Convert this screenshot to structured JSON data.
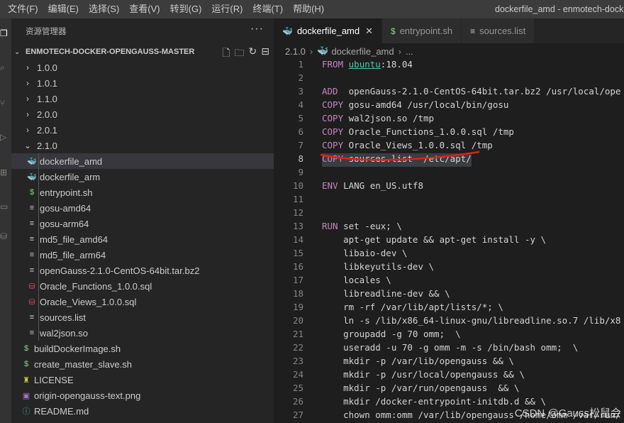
{
  "menu": [
    "文件(F)",
    "编辑(E)",
    "选择(S)",
    "查看(V)",
    "转到(G)",
    "运行(R)",
    "终端(T)",
    "帮助(H)"
  ],
  "window_title": "dockerfile_amd - enmotech-docke",
  "sidebar": {
    "title": "资源管理器",
    "more": "···",
    "root": "ENMOTECH-DOCKER-OPENGAUSS-MASTER",
    "tree": [
      {
        "label": "1.0.0",
        "kind": "folder"
      },
      {
        "label": "1.0.1",
        "kind": "folder"
      },
      {
        "label": "1.1.0",
        "kind": "folder"
      },
      {
        "label": "2.0.0",
        "kind": "folder"
      },
      {
        "label": "2.0.1",
        "kind": "folder"
      },
      {
        "label": "2.1.0",
        "kind": "folder-open"
      },
      {
        "label": "dockerfile_amd",
        "kind": "docker",
        "child": true,
        "selected": true
      },
      {
        "label": "dockerfile_arm",
        "kind": "docker",
        "child": true
      },
      {
        "label": "entrypoint.sh",
        "kind": "shell",
        "child": true
      },
      {
        "label": "gosu-amd64",
        "kind": "file",
        "child": true
      },
      {
        "label": "gosu-arm64",
        "kind": "file",
        "child": true
      },
      {
        "label": "md5_file_amd64",
        "kind": "file",
        "child": true
      },
      {
        "label": "md5_file_arm64",
        "kind": "file",
        "child": true
      },
      {
        "label": "openGauss-2.1.0-CentOS-64bit.tar.bz2",
        "kind": "file",
        "child": true
      },
      {
        "label": "Oracle_Functions_1.0.0.sql",
        "kind": "sql",
        "child": true
      },
      {
        "label": "Oracle_Views_1.0.0.sql",
        "kind": "sql",
        "child": true
      },
      {
        "label": "sources.list",
        "kind": "file",
        "child": true
      },
      {
        "label": "wal2json.so",
        "kind": "file",
        "child": true
      },
      {
        "label": "buildDockerImage.sh",
        "kind": "shell"
      },
      {
        "label": "create_master_slave.sh",
        "kind": "shell"
      },
      {
        "label": "LICENSE",
        "kind": "license"
      },
      {
        "label": "origin-opengauss-text.png",
        "kind": "image"
      },
      {
        "label": "README.md",
        "kind": "info"
      }
    ]
  },
  "tabs": [
    {
      "label": "dockerfile_amd",
      "icon": "docker-icon",
      "active": true,
      "close": "✕"
    },
    {
      "label": "entrypoint.sh",
      "icon": "shell-icon",
      "active": false
    },
    {
      "label": "sources.list",
      "icon": "list-icon",
      "active": false
    }
  ],
  "breadcrumb": {
    "folder": "2.1.0",
    "file": "dockerfile_amd",
    "tail": "..."
  },
  "code": [
    {
      "n": "1",
      "kw": "FROM",
      "img": "ubuntu",
      "rest": ":18.04"
    },
    {
      "n": "2",
      "kw": "",
      "rest": ""
    },
    {
      "n": "3",
      "kw": "ADD",
      "rest": "  openGauss-2.1.0-CentOS-64bit.tar.bz2 /usr/local/ope"
    },
    {
      "n": "4",
      "kw": "COPY",
      "rest": " gosu-amd64 /usr/local/bin/gosu"
    },
    {
      "n": "5",
      "kw": "COPY",
      "rest": " wal2json.so /tmp"
    },
    {
      "n": "6",
      "kw": "COPY",
      "rest": " Oracle_Functions_1.0.0.sql /tmp"
    },
    {
      "n": "7",
      "kw": "COPY",
      "rest": " Oracle_Views_1.0.0.sql /tmp"
    },
    {
      "n": "8",
      "kw": "COPY",
      "rest": " sources.list  /etc/apt/",
      "current": true
    },
    {
      "n": "9",
      "kw": "",
      "rest": ""
    },
    {
      "n": "10",
      "kw": "ENV",
      "rest": " LANG en_US.utf8"
    },
    {
      "n": "11",
      "kw": "",
      "rest": ""
    },
    {
      "n": "12",
      "kw": "",
      "rest": ""
    },
    {
      "n": "13",
      "kw": "RUN",
      "rest": " set -eux; \\"
    },
    {
      "n": "14",
      "kw": "",
      "rest": "    apt-get update && apt-get install -y \\"
    },
    {
      "n": "15",
      "kw": "",
      "rest": "    libaio-dev \\"
    },
    {
      "n": "16",
      "kw": "",
      "rest": "    libkeyutils-dev \\"
    },
    {
      "n": "17",
      "kw": "",
      "rest": "    locales \\"
    },
    {
      "n": "18",
      "kw": "",
      "rest": "    libreadline-dev && \\"
    },
    {
      "n": "19",
      "kw": "",
      "rest": "    rm -rf /var/lib/apt/lists/*; \\"
    },
    {
      "n": "20",
      "kw": "",
      "rest": "    ln -s /lib/x86_64-linux-gnu/libreadline.so.7 /lib/x8"
    },
    {
      "n": "21",
      "kw": "",
      "rest": "    groupadd -g 70 omm;  \\"
    },
    {
      "n": "22",
      "kw": "",
      "rest": "    useradd -u 70 -g omm -m -s /bin/bash omm;  \\"
    },
    {
      "n": "23",
      "kw": "",
      "rest": "    mkdir -p /var/lib/opengauss && \\"
    },
    {
      "n": "24",
      "kw": "",
      "rest": "    mkdir -p /usr/local/opengauss && \\"
    },
    {
      "n": "25",
      "kw": "",
      "rest": "    mkdir -p /var/run/opengauss  && \\"
    },
    {
      "n": "26",
      "kw": "",
      "rest": "    mkdir /docker-entrypoint-initdb.d && \\"
    },
    {
      "n": "27",
      "kw": "",
      "rest": "    chown omm:omm /var/lib/opengauss /home/omm /var/run/"
    }
  ],
  "watermark": "CSDN @Gauss松鼠会",
  "colors": {
    "keyword": "#c586c0",
    "image": "#4ec9b0",
    "annotation": "#e0201a",
    "docker": "#2496ed",
    "shell": "#89d185",
    "sql": "#e64c5d"
  }
}
